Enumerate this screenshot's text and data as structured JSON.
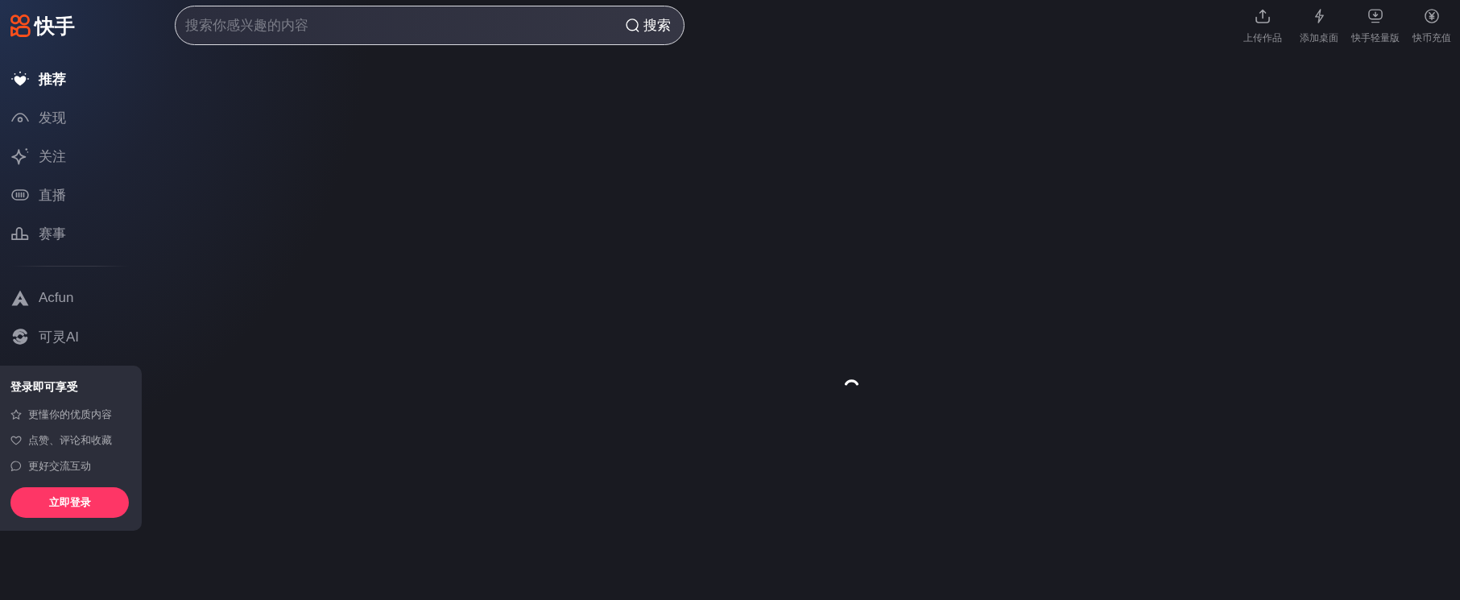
{
  "logo": {
    "text": "快手"
  },
  "search": {
    "placeholder": "搜索你感兴趣的内容",
    "button": "搜索"
  },
  "top_actions": [
    {
      "label": "上传作品"
    },
    {
      "label": "添加桌面"
    },
    {
      "label": "快手轻量版"
    },
    {
      "label": "快币充值"
    }
  ],
  "sidebar": {
    "items": [
      {
        "label": "推荐",
        "selected": true
      },
      {
        "label": "发现",
        "selected": false
      },
      {
        "label": "关注",
        "selected": false
      },
      {
        "label": "直播",
        "selected": false
      },
      {
        "label": "赛事",
        "selected": false
      }
    ],
    "extra_items": [
      {
        "label": "Acfun",
        "selected": false
      },
      {
        "label": "可灵AI",
        "selected": false
      }
    ]
  },
  "login_card": {
    "title": "登录即可享受",
    "benefits": [
      "更懂你的优质内容",
      "点赞、评论和收藏",
      "更好交流互动"
    ],
    "button": "立即登录"
  }
}
